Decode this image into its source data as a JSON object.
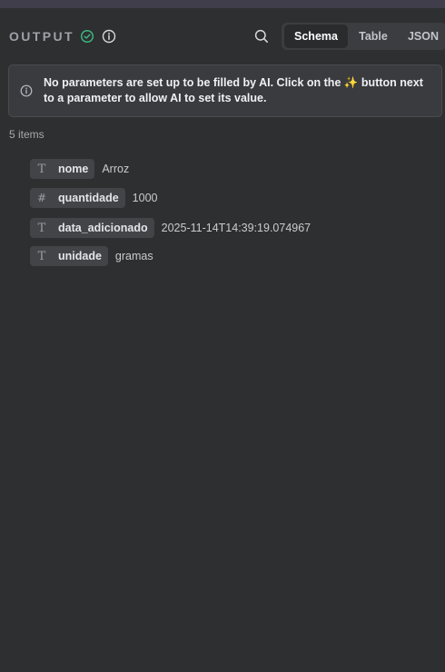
{
  "header": {
    "title": "OUTPUT",
    "status_icon": "check-circle-icon",
    "info_icon": "info-icon",
    "search_icon": "search-icon"
  },
  "view_tabs": [
    {
      "label": "Schema",
      "active": true
    },
    {
      "label": "Table",
      "active": false
    },
    {
      "label": "JSON",
      "active": false
    }
  ],
  "banner": {
    "text_before": "No parameters are set up to be filled by AI. Click on the ",
    "sparkle": "✨",
    "text_after": " button next to a parameter to allow AI to set its value."
  },
  "items_count": "5 items",
  "fields": [
    {
      "type_glyph": "T",
      "type_icon": "text-type-icon",
      "name": "nome",
      "value": "Arroz"
    },
    {
      "type_glyph": "#",
      "type_icon": "number-type-icon",
      "name": "quantidade",
      "value": "1000"
    },
    {
      "type_glyph": "T",
      "type_icon": "text-type-icon",
      "name": "data_adicionado",
      "value": "2025-11-14T14:39:19.074967"
    },
    {
      "type_glyph": "T",
      "type_icon": "text-type-icon",
      "name": "unidade",
      "value": "gramas"
    }
  ],
  "colors": {
    "background": "#2e2f31",
    "success": "#3bb77e",
    "banner_bg": "#3a3b3f",
    "pill_bg": "#434448"
  }
}
